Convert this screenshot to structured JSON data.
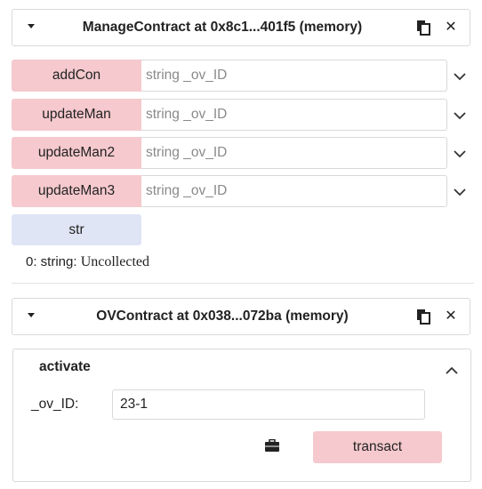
{
  "contracts": [
    {
      "title": "ManageContract at 0x8c1...401f5 (memory)",
      "functions": [
        {
          "label": "addCon",
          "placeholder": "string _ov_ID",
          "color": "#f5c9cd"
        },
        {
          "label": "updateMan",
          "placeholder": "string _ov_ID",
          "color": "#f5c9cd"
        },
        {
          "label": "updateMan2",
          "placeholder": "string _ov_ID",
          "color": "#f5c9cd"
        },
        {
          "label": "updateMan3",
          "placeholder": "string _ov_ID",
          "color": "#f5c9cd"
        }
      ],
      "call": {
        "label": "str",
        "color": "#dfe5f5"
      },
      "result": {
        "prefix": "0: string: ",
        "value": "Uncollected"
      }
    },
    {
      "title": "OVContract at 0x038...072ba (memory)",
      "function": {
        "name": "activate",
        "param_label": "_ov_ID:",
        "param_value": "23-1",
        "transact_label": "transact"
      }
    }
  ],
  "icons": {
    "caret": "caret-down-icon",
    "copy": "copy-clipboard-icon",
    "close": "close-icon",
    "chevron": "chevron-down-icon",
    "chevron_up": "chevron-up-icon",
    "briefcase": "briefcase-icon"
  }
}
